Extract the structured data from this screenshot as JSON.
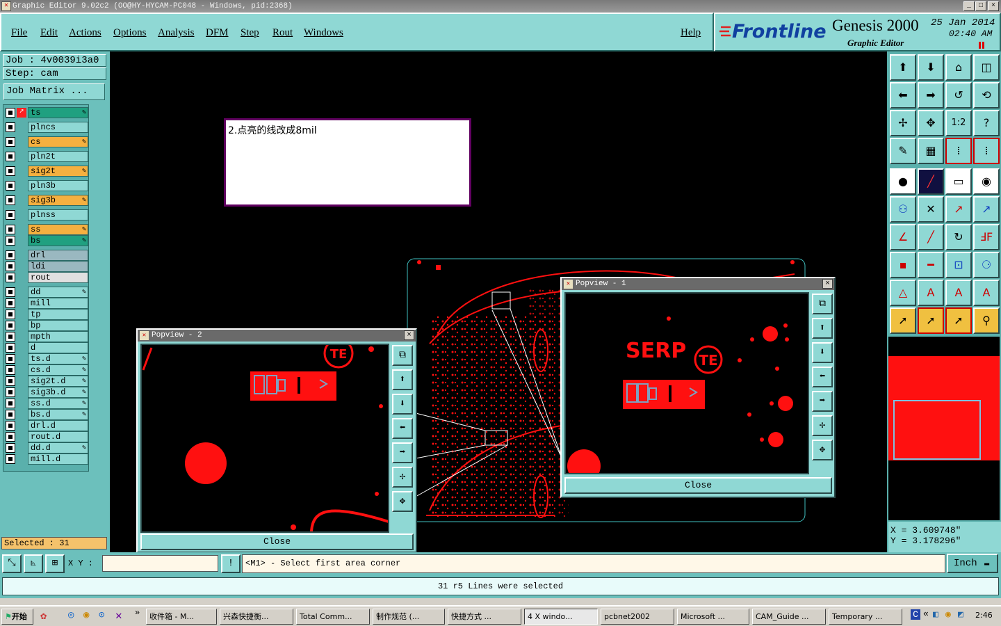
{
  "window": {
    "title": "Graphic Editor 9.02c2 (OO@HY-HYCAM-PC048 - Windows, pid:2368)"
  },
  "menu": {
    "items": [
      "File",
      "Edit",
      "Actions",
      "Options",
      "Analysis",
      "DFM",
      "Step",
      "Rout",
      "Windows"
    ],
    "help": "Help"
  },
  "brand": {
    "logo": "Frontline",
    "product": "Genesis 2000",
    "subtitle": "Graphic Editor",
    "date": "25 Jan 2014",
    "time": "02:40 AM"
  },
  "job": {
    "job_label": "Job : 4v0039i3a0",
    "step_label": "Step: cam",
    "matrix_button": "Job Matrix ..."
  },
  "layers": [
    {
      "name": "ts",
      "color": "#20a080",
      "pen": true,
      "active": true
    },
    {
      "name": "plncs",
      "color": "#8fd8d4",
      "pen": false
    },
    {
      "name": "cs",
      "color": "#f5b040",
      "pen": true
    },
    {
      "name": "pln2t",
      "color": "#8fd8d4",
      "pen": false
    },
    {
      "name": "sig2t",
      "color": "#f5b040",
      "pen": true
    },
    {
      "name": "pln3b",
      "color": "#8fd8d4",
      "pen": false
    },
    {
      "name": "sig3b",
      "color": "#f5b040",
      "pen": true
    },
    {
      "name": "plnss",
      "color": "#8fd8d4",
      "pen": false
    },
    {
      "name": "ss",
      "color": "#f5b040",
      "pen": true
    },
    {
      "name": "bs",
      "color": "#20a080",
      "pen": true
    },
    {
      "name": "drl",
      "color": "#9ab8c0",
      "pen": false
    },
    {
      "name": "ldi",
      "color": "#9ab8c0",
      "pen": false
    },
    {
      "name": "rout",
      "color": "#e0e0e0",
      "pen": false
    },
    {
      "name": "dd",
      "color": "#8fd8d4",
      "pen": true
    },
    {
      "name": "mill",
      "color": "#8fd8d4",
      "pen": false
    },
    {
      "name": "tp",
      "color": "#8fd8d4",
      "pen": false
    },
    {
      "name": "bp",
      "color": "#8fd8d4",
      "pen": false
    },
    {
      "name": "mpth",
      "color": "#8fd8d4",
      "pen": false
    },
    {
      "name": "d",
      "color": "#8fd8d4",
      "pen": false
    },
    {
      "name": "ts.d",
      "color": "#8fd8d4",
      "pen": true
    },
    {
      "name": "cs.d",
      "color": "#8fd8d4",
      "pen": true
    },
    {
      "name": "sig2t.d",
      "color": "#8fd8d4",
      "pen": true
    },
    {
      "name": "sig3b.d",
      "color": "#8fd8d4",
      "pen": true
    },
    {
      "name": "ss.d",
      "color": "#8fd8d4",
      "pen": true
    },
    {
      "name": "bs.d",
      "color": "#8fd8d4",
      "pen": true
    },
    {
      "name": "drl.d",
      "color": "#8fd8d4",
      "pen": false
    },
    {
      "name": "rout.d",
      "color": "#8fd8d4",
      "pen": false
    },
    {
      "name": "dd.d",
      "color": "#8fd8d4",
      "pen": true
    },
    {
      "name": "mill.d",
      "color": "#8fd8d4",
      "pen": false
    }
  ],
  "selected": "Selected : 31",
  "note": "2.点亮的线改成8mil",
  "popview1": {
    "title": "Popview - 1",
    "close": "Close",
    "silk_text": "SERP",
    "logo_text": "TE"
  },
  "popview2": {
    "title": "Popview - 2",
    "close": "Close",
    "logo_text": "TE"
  },
  "coords": {
    "x": "X = 3.609748\"",
    "y": "Y = 3.178296\""
  },
  "command": {
    "xy_label": "X Y :",
    "xy_value": "",
    "prompt": "<M1> - Select first area corner",
    "unit": "Inch"
  },
  "status": "31 r5 Lines were selected",
  "taskbar": {
    "start": "开始",
    "tasks": [
      "收件箱 - M...",
      "兴森快捷衡...",
      "Total Comm...",
      "制作规范 (...",
      "快捷方式 ...",
      "4 X windo...",
      "pcbnet2002",
      "Microsoft ...",
      "CAM_Guide ...",
      "Temporary ..."
    ],
    "clock": "2:46"
  },
  "colors": {
    "accent": "#8fd8d4",
    "copper": "#ff1010",
    "selected_bg": "#f5c26b"
  }
}
